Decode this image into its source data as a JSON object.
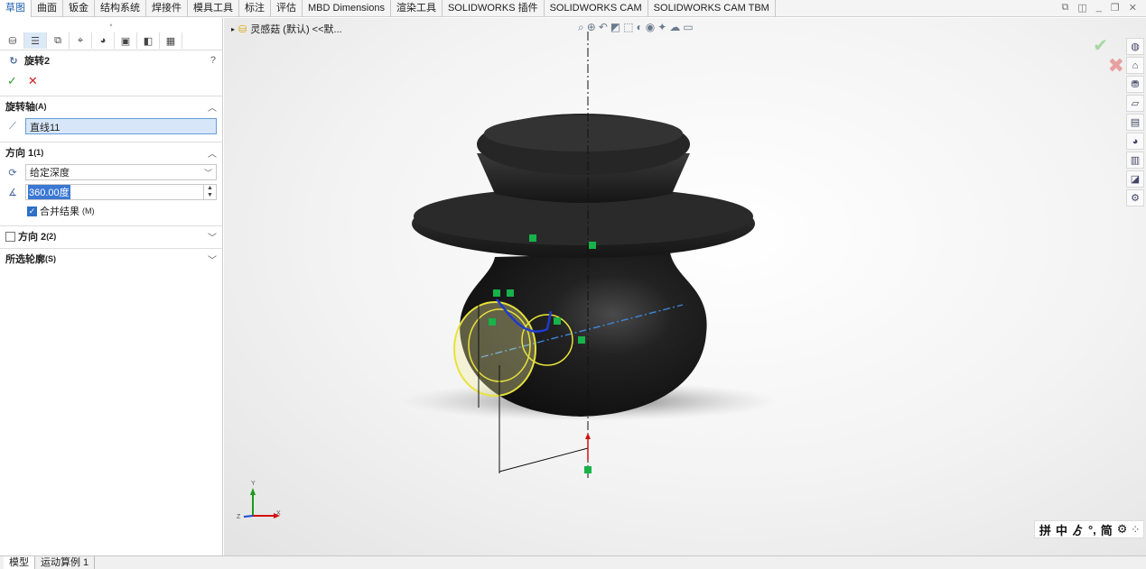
{
  "top_tabs": [
    "草图",
    "曲面",
    "钣金",
    "结构系统",
    "焊接件",
    "模具工具",
    "标注",
    "评估",
    "MBD Dimensions",
    "渲染工具",
    "SOLIDWORKS 插件",
    "SOLIDWORKS CAM",
    "SOLIDWORKS CAM TBM"
  ],
  "panel": {
    "feature_title": "旋转2",
    "axis_section": {
      "label": "旋转轴",
      "key": "(A)",
      "value": "直线11"
    },
    "direction1": {
      "label": "方向 1",
      "key": "(1)",
      "type": "给定深度",
      "angle": "360.00度",
      "merge_label": "合并结果",
      "merge_key": "(M)",
      "merge_checked": true
    },
    "direction2": {
      "label": "方向 2",
      "key": "(2)",
      "checked": false
    },
    "contours": {
      "label": "所选轮廓",
      "key": "(S)"
    }
  },
  "viewport": {
    "crumb": "灵感菇 (默认) <<默...",
    "axis_labels": {
      "x": "X",
      "y": "Y",
      "z": "Z"
    }
  },
  "ime": [
    "拼",
    "中",
    "ゟ",
    "°,",
    "简",
    "⚙",
    "⁘"
  ],
  "bottom_tabs": [
    "模型",
    "运动算例 1"
  ],
  "colors": {
    "accent": "#2e6fc8",
    "body": "#1a1a1a",
    "selection": "#e8e23a"
  }
}
